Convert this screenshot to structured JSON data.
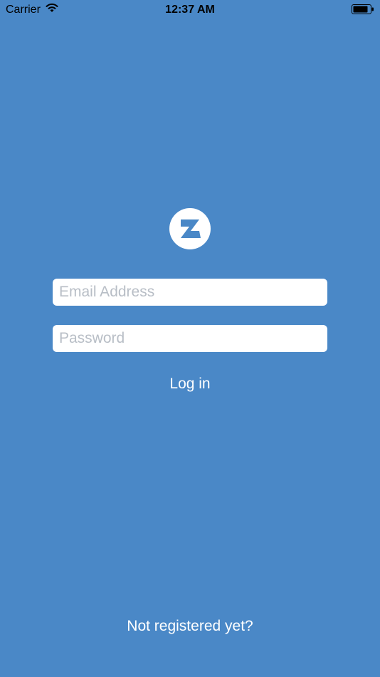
{
  "colors": {
    "background": "#4a88c7",
    "text": "#ffffff",
    "logo_circle": "#ffffff",
    "logo_mark": "#4a88c7",
    "input_background": "#ffffff",
    "placeholder": "#b8bec6"
  },
  "status_bar": {
    "carrier": "Carrier",
    "time": "12:37 AM",
    "wifi_icon": "wifi-icon",
    "battery_icon": "battery-icon"
  },
  "logo": {
    "icon": "z-logo-icon"
  },
  "form": {
    "email": {
      "placeholder": "Email Address",
      "value": ""
    },
    "password": {
      "placeholder": "Password",
      "value": ""
    },
    "login_label": "Log in",
    "register_label": "Not registered yet?"
  }
}
